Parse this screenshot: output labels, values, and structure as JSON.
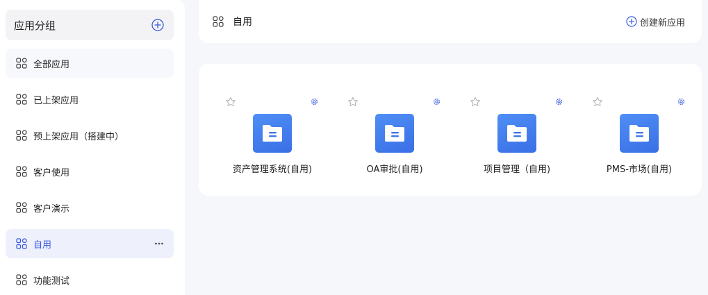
{
  "sidebar": {
    "group_title": "应用分组",
    "items": [
      {
        "label": "全部应用"
      },
      {
        "label": "已上架应用"
      },
      {
        "label": "预上架应用（搭建中）"
      },
      {
        "label": "客户使用"
      },
      {
        "label": "客户演示"
      },
      {
        "label": "自用"
      },
      {
        "label": "功能测试"
      }
    ],
    "active_index": 5
  },
  "topbar": {
    "title": "自用",
    "create_label": "创建新应用"
  },
  "apps": [
    {
      "name": "资产管理系统(自用)",
      "icon": "folder-doc-icon"
    },
    {
      "name": "OA审批(自用)",
      "icon": "folder-doc-icon"
    },
    {
      "name": "项目管理（自用)",
      "icon": "folder-doc-icon"
    },
    {
      "name": "PMS-市场(自用)",
      "icon": "folder-doc-icon"
    }
  ],
  "colors": {
    "accent": "#3355dd",
    "app_icon": "#4a85f0",
    "active_bg": "#eef1fc"
  }
}
